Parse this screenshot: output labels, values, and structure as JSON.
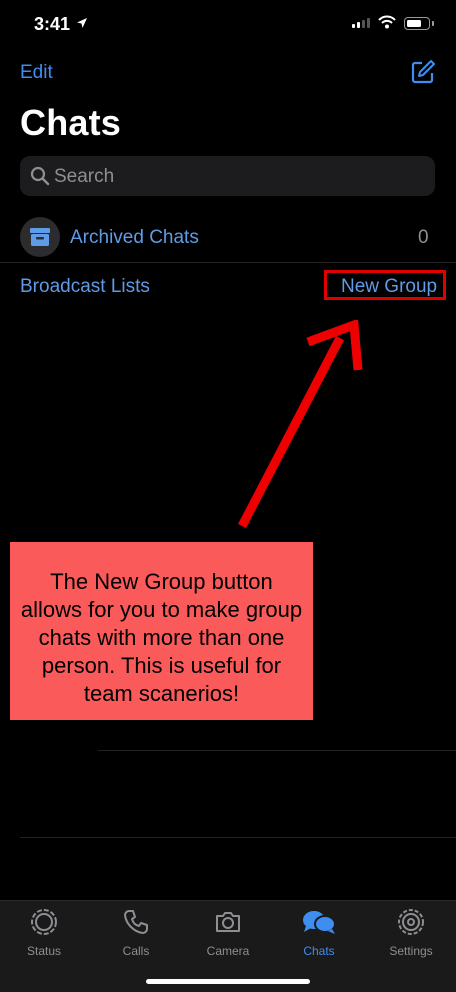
{
  "status_bar": {
    "time": "3:41"
  },
  "header": {
    "edit_label": "Edit",
    "title": "Chats"
  },
  "search": {
    "placeholder": "Search"
  },
  "archived": {
    "label": "Archived Chats",
    "count": "0"
  },
  "links": {
    "broadcast_label": "Broadcast Lists",
    "new_group_label": "New Group"
  },
  "annotation": {
    "text": "The New Group button allows for you to make group chats with more than one person. This is useful for team scanerios!"
  },
  "tabs": [
    {
      "label": "Status",
      "icon": "status-icon"
    },
    {
      "label": "Calls",
      "icon": "phone-icon"
    },
    {
      "label": "Camera",
      "icon": "camera-icon"
    },
    {
      "label": "Chats",
      "icon": "chats-icon"
    },
    {
      "label": "Settings",
      "icon": "gear-icon"
    }
  ],
  "colors": {
    "accent": "#3d8ef0",
    "annotation_bg": "#fa5a5a",
    "highlight": "#e00000"
  }
}
